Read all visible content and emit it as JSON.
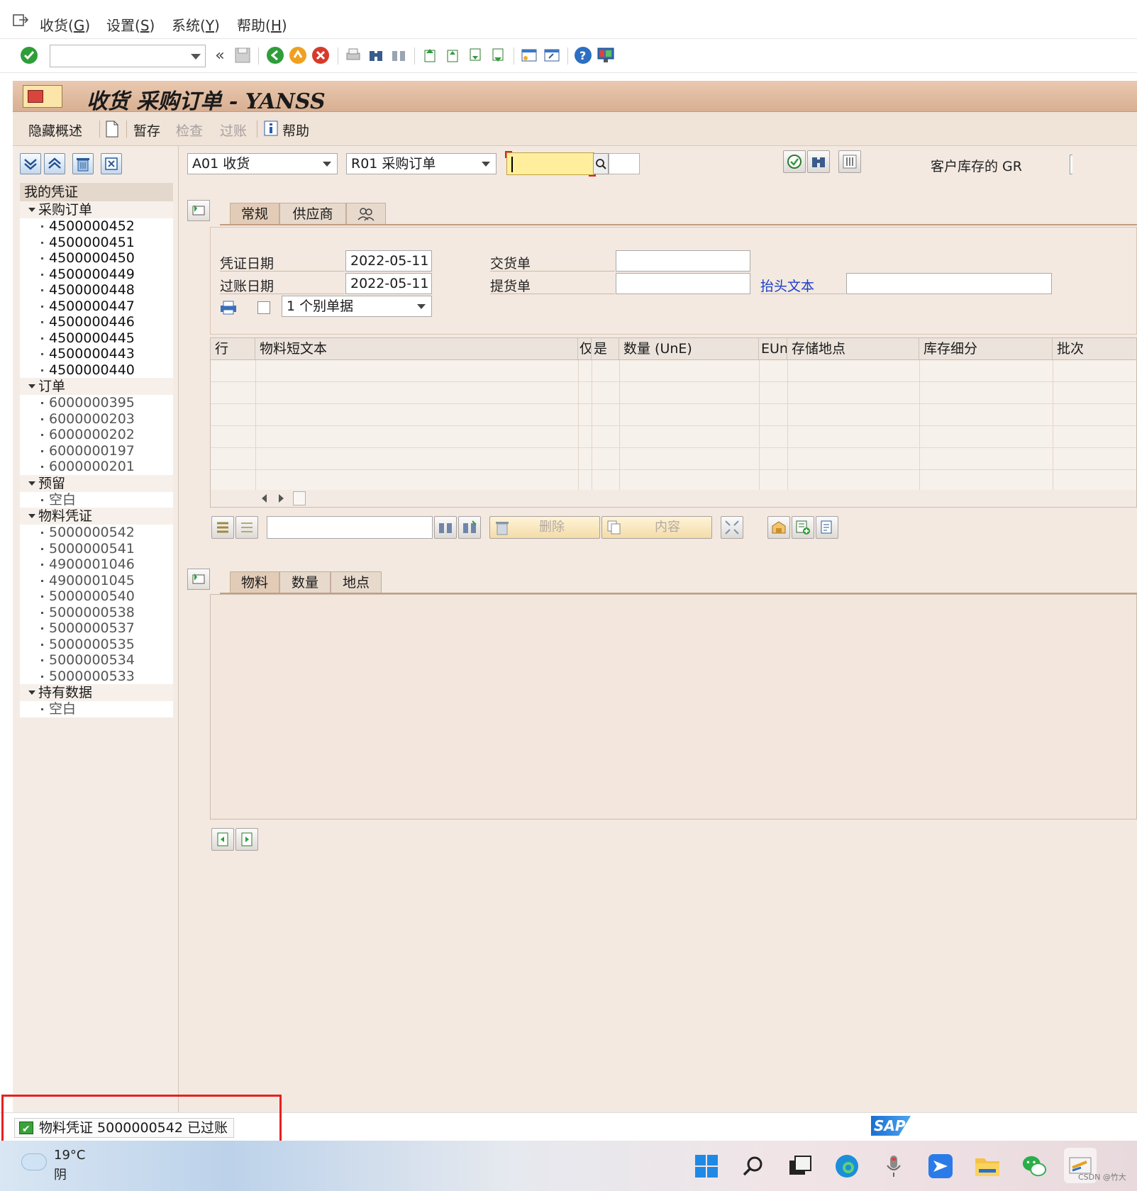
{
  "menu": {
    "items": [
      {
        "label": "收货",
        "key": "G"
      },
      {
        "label": "设置",
        "key": "S"
      },
      {
        "label": "系统",
        "key": "Y"
      },
      {
        "label": "帮助",
        "key": "H"
      }
    ]
  },
  "window": {
    "title": "收货 采购订单 - YANSS"
  },
  "app_toolbar": {
    "hide_overview": "隐藏概述",
    "hold": "暂存",
    "check": "检查",
    "post": "过账",
    "help": "帮助"
  },
  "tree": {
    "header": "我的凭证",
    "groups": [
      {
        "label": "采购订单",
        "items": [
          "4500000452",
          "4500000451",
          "4500000450",
          "4500000449",
          "4500000448",
          "4500000447",
          "4500000446",
          "4500000445",
          "4500000443",
          "4500000440"
        ]
      },
      {
        "label": "订单",
        "items": [
          "6000000395",
          "6000000203",
          "6000000202",
          "6000000197",
          "6000000201"
        ]
      },
      {
        "label": "预留",
        "items": [
          "空白"
        ]
      },
      {
        "label": "物料凭证",
        "items": [
          "5000000542",
          "5000000541",
          "4900001046",
          "4900001045",
          "5000000540",
          "5000000538",
          "5000000537",
          "5000000535",
          "5000000534",
          "5000000533"
        ]
      },
      {
        "label": "持有数据",
        "items": [
          "空白"
        ]
      }
    ]
  },
  "selection": {
    "transaction": "A01 收货",
    "reference": "R01 采购订单",
    "ref_value": "",
    "customer_stock_gr": "客户库存的 GR"
  },
  "header_tabs": [
    "常规",
    "供应商"
  ],
  "header": {
    "doc_date_label": "凭证日期",
    "doc_date": "2022-05-11",
    "post_date_label": "过账日期",
    "post_date": "2022-05-11",
    "slip_option": "1 个别单据",
    "delivery_note_label": "交货单",
    "delivery_note": "",
    "bill_of_lading_label": "提货单",
    "bill_of_lading": "",
    "header_text_label": "抬头文本",
    "header_text": ""
  },
  "grid": {
    "columns": [
      "行",
      "物料短文本",
      "仅",
      "是",
      "数量 (UnE)",
      "EUn",
      "存储地点",
      "库存细分",
      "批次"
    ]
  },
  "item_toolbar": {
    "delete": "删除",
    "content": "内容"
  },
  "detail_tabs": [
    "物料",
    "数量",
    "地点"
  ],
  "status": {
    "message": "物料凭证 5000000542 已过账"
  },
  "taskbar": {
    "temperature": "19°C",
    "weather": "阴",
    "watermark": "CSDN @竹大"
  },
  "colors": {
    "accent_title": "#d8af92",
    "highlight": "#e52020",
    "link": "#1a3ec8"
  }
}
